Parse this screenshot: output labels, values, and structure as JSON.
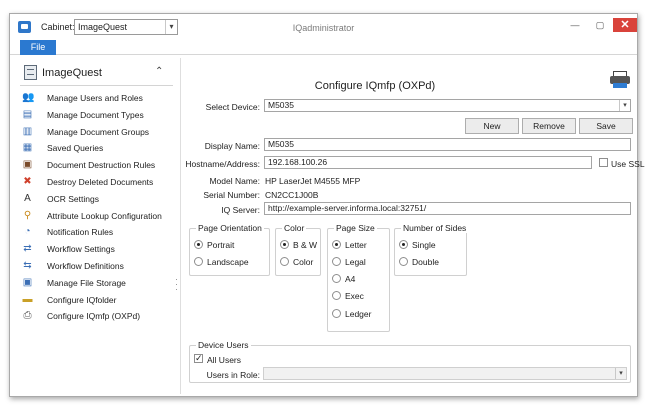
{
  "window": {
    "title": "IQadministrator",
    "cabinet_label": "Cabinet:",
    "cabinet_value": "ImageQuest",
    "close_glyph": "✕",
    "min_glyph": "—",
    "max_glyph": "▢",
    "close_color": "#d9433b"
  },
  "menu": {
    "file_label": "File",
    "accent": "#2b79d0"
  },
  "sidebar": {
    "title": "ImageQuest",
    "collapse_glyph": "⌃",
    "items": [
      {
        "label": "Manage Users and Roles",
        "icon": "users-icon"
      },
      {
        "label": "Manage Document Types",
        "icon": "document-type-icon"
      },
      {
        "label": "Manage Document Groups",
        "icon": "document-group-icon"
      },
      {
        "label": "Saved Queries",
        "icon": "saved-query-icon"
      },
      {
        "label": "Document Destruction Rules",
        "icon": "destruction-rules-icon"
      },
      {
        "label": "Destroy Deleted Documents",
        "icon": "destroy-icon"
      },
      {
        "label": "OCR Settings",
        "icon": "ocr-icon"
      },
      {
        "label": "Attribute Lookup Configuration",
        "icon": "lookup-icon"
      },
      {
        "label": "Notification Rules",
        "icon": "notification-icon"
      },
      {
        "label": "Workflow Settings",
        "icon": "workflow-settings-icon"
      },
      {
        "label": "Workflow Definitions",
        "icon": "workflow-definitions-icon"
      },
      {
        "label": "Manage File Storage",
        "icon": "storage-icon"
      },
      {
        "label": "Configure IQfolder",
        "icon": "iqfolder-icon"
      },
      {
        "label": "Configure IQmfp (OXPd)",
        "icon": "iqmfp-icon"
      }
    ]
  },
  "main": {
    "title": "Configure IQmfp (OXPd)",
    "select_device_label": "Select Device:",
    "select_device_value": "M5035",
    "buttons": {
      "new": "New",
      "remove": "Remove",
      "save": "Save"
    },
    "display_name_label": "Display Name:",
    "display_name_value": "M5035",
    "hostname_label": "Hostname/Address:",
    "hostname_value": "192.168.100.26",
    "use_ssl_label": "Use SSL",
    "model_label": "Model Name:",
    "model_value": "HP LaserJet M4555 MFP",
    "serial_label": "Serial Number:",
    "serial_value": "CN2CC1J00B",
    "iqserver_label": "IQ Server:",
    "iqserver_value": "http://example-server.informa.local:32751/",
    "orientation": {
      "title": "Page Orientation",
      "options": [
        "Portrait",
        "Landscape"
      ],
      "selected": "Portrait"
    },
    "color": {
      "title": "Color",
      "options": [
        "B & W",
        "Color"
      ],
      "selected": "B & W"
    },
    "page_size": {
      "title": "Page Size",
      "options": [
        "Letter",
        "Legal",
        "A4",
        "Exec",
        "Ledger"
      ],
      "selected": "Letter"
    },
    "sides": {
      "title": "Number of Sides",
      "options": [
        "Single",
        "Double"
      ],
      "selected": "Single"
    },
    "device_users": {
      "title": "Device Users",
      "all_users_label": "All Users",
      "all_users_checked": true,
      "users_in_role_label": "Users in Role:",
      "users_in_role_value": ""
    }
  }
}
